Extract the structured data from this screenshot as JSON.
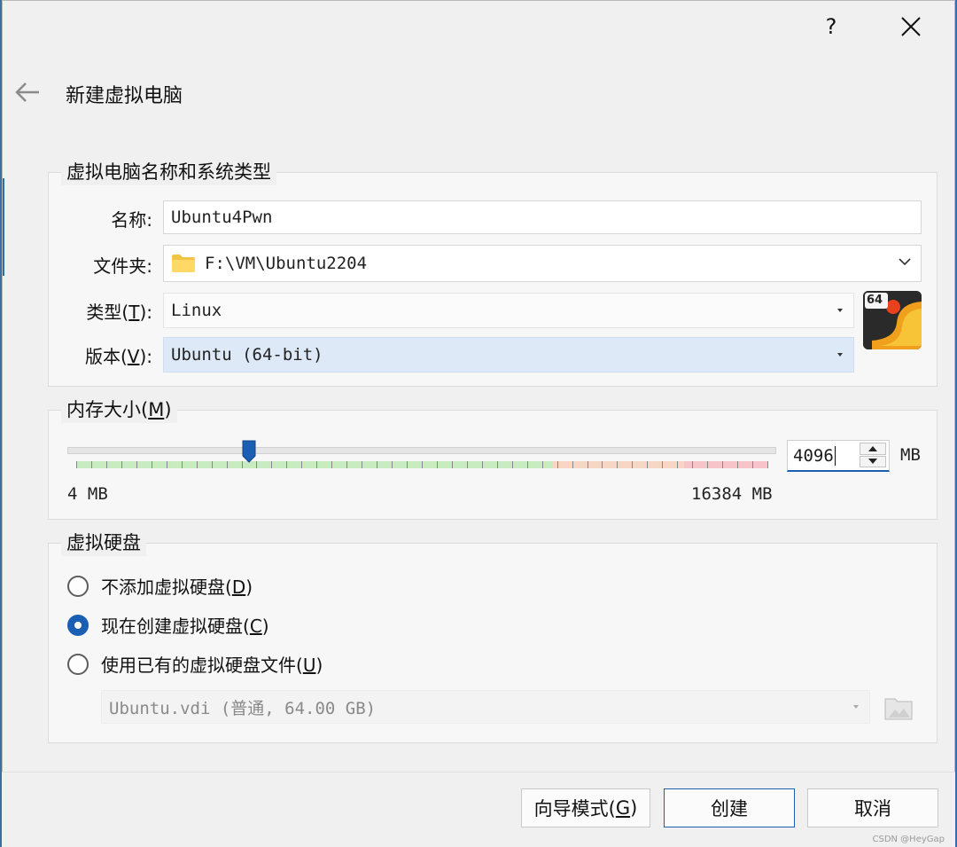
{
  "window": {
    "help": "?",
    "close": "✕",
    "title": "新建虚拟电脑"
  },
  "name_group": {
    "legend": "虚拟电脑名称和系统类型",
    "name_label": "名称:",
    "name_value": "Ubuntu4Pwn",
    "folder_label": "文件夹:",
    "folder_value": "F:\\VM\\Ubuntu2204",
    "type_label_pre": "类型(",
    "type_label_key": "T",
    "type_label_post": "):",
    "type_value": "Linux",
    "version_label_pre": "版本(",
    "version_label_key": "V",
    "version_label_post": "):",
    "version_value": "Ubuntu (64-bit)",
    "os_badge": "64"
  },
  "memory_group": {
    "legend_pre": "内存大小(",
    "legend_key": "M",
    "legend_post": ")",
    "min_label": "4 MB",
    "max_label": "16384 MB",
    "value": "4096",
    "unit": "MB",
    "slider_fraction": 0.25
  },
  "disk_group": {
    "legend": "虚拟硬盘",
    "options": [
      {
        "pre": "不添加虚拟硬盘(",
        "key": "D",
        "post": ")",
        "checked": false
      },
      {
        "pre": "现在创建虚拟硬盘(",
        "key": "C",
        "post": ")",
        "checked": true
      },
      {
        "pre": "使用已有的虚拟硬盘文件(",
        "key": "U",
        "post": ")",
        "checked": false
      }
    ],
    "existing_disk": "Ubuntu.vdi (普通, 64.00 GB)"
  },
  "footer": {
    "guided_pre": "向导模式(",
    "guided_key": "G",
    "guided_post": ")",
    "create": "创建",
    "cancel": "取消"
  },
  "watermark": "CSDN @HeyGap",
  "colors": {
    "accent": "#1a5fb4",
    "selection": "#dde9f6",
    "scale_green": "#c8ecc0",
    "scale_orange": "#f7d6c6",
    "scale_red": "#f7c4c9"
  }
}
